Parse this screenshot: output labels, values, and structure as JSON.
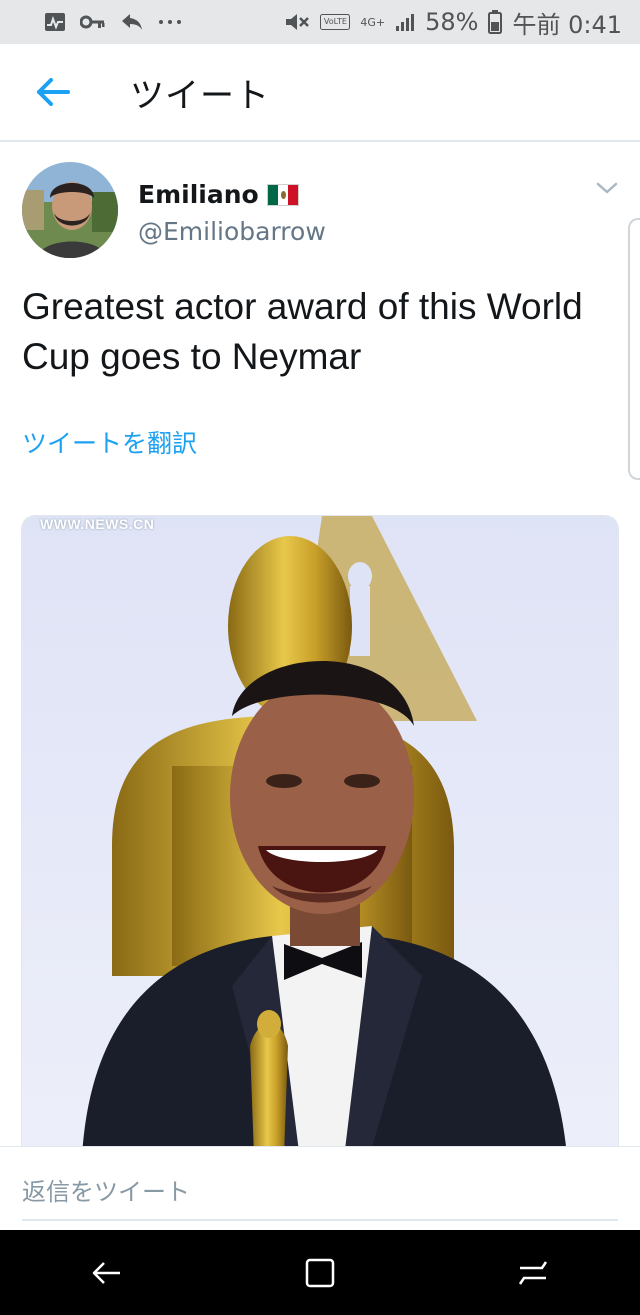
{
  "status_bar": {
    "battery": "58%",
    "time": "午前 0:41",
    "network": "4G+",
    "volte": "VoLTE",
    "icons": [
      "activity-icon",
      "key-icon",
      "reply-icon",
      "more-dots-icon",
      "mute-icon",
      "signal-icon",
      "battery-icon"
    ]
  },
  "header": {
    "title": "ツイート",
    "back_icon": "back-arrow-icon"
  },
  "tweet": {
    "display_name": "Emiliano",
    "flag": "mexico-flag",
    "username": "@Emiliobarrow",
    "text": "Greatest actor award of this World Cup goes to Neymar",
    "translate_label": "ツイートを翻訳",
    "media_watermark": "WWW.NEWS.CN"
  },
  "reply": {
    "placeholder": "返信をツイート"
  },
  "nav": {
    "buttons": [
      "back-nav-icon",
      "home-nav-icon",
      "recents-nav-icon"
    ]
  },
  "colors": {
    "accent": "#1da1f2",
    "text": "#14171a",
    "secondary": "#657786",
    "status_bg": "#e6e7e8",
    "nav_bg": "#000000"
  }
}
